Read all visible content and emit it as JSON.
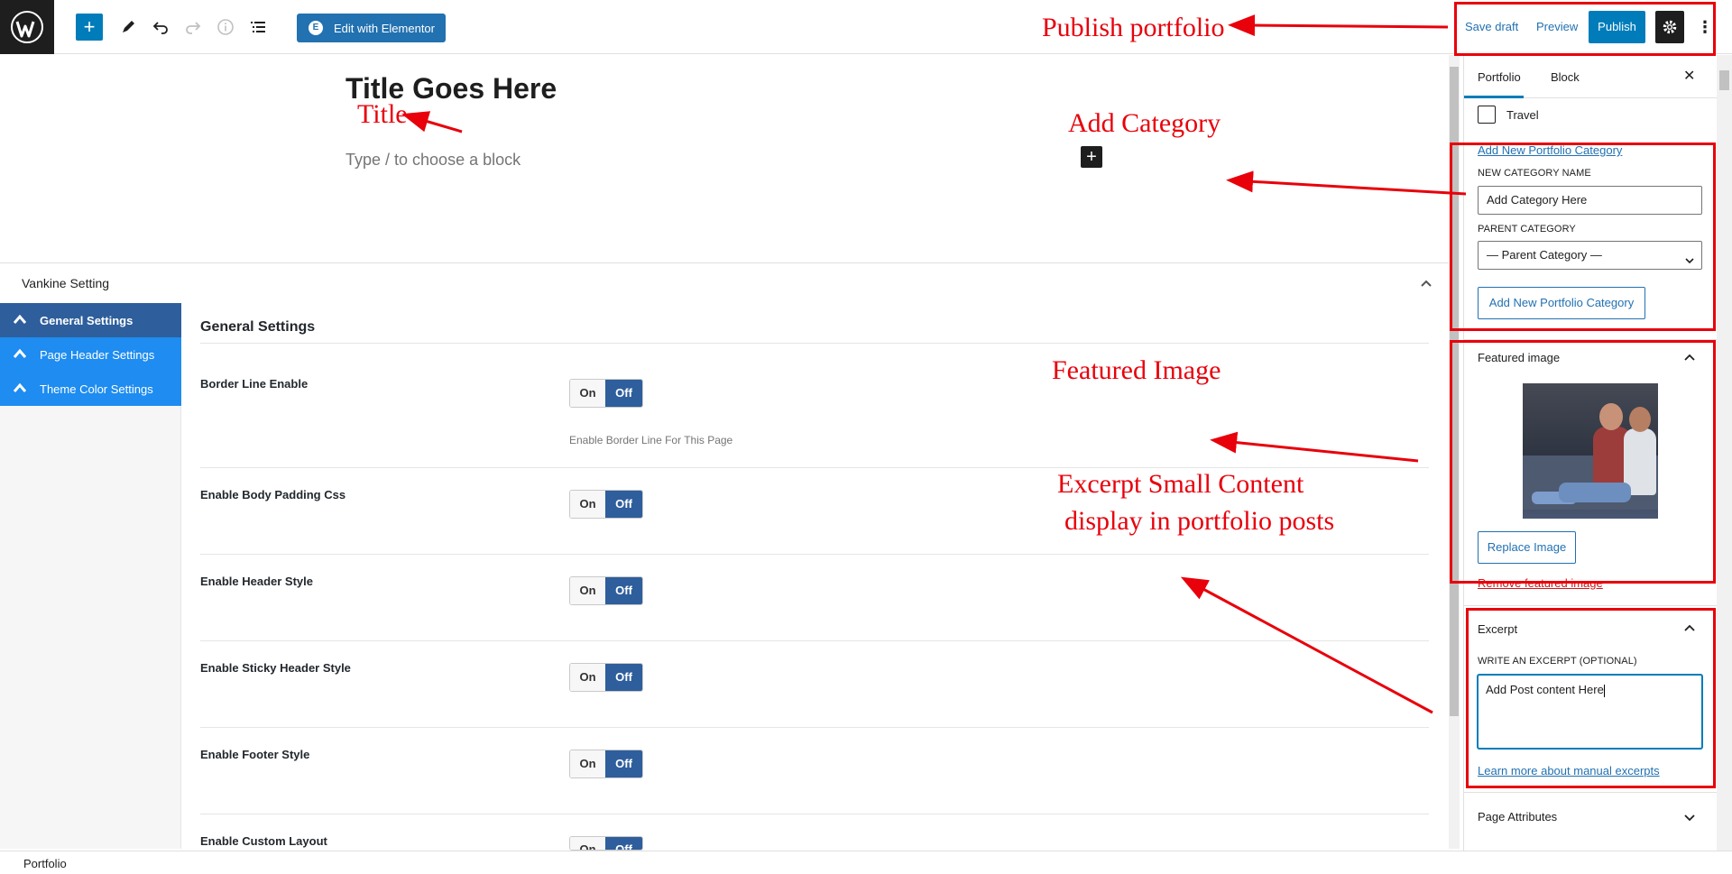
{
  "toolbar": {
    "add_label": "+",
    "elementor_label": "Edit with Elementor",
    "elementor_icon": "E",
    "save_draft": "Save draft",
    "preview": "Preview",
    "publish": "Publish",
    "more": "⋮",
    "accent_color": "#007cba"
  },
  "editor": {
    "post_title": "Title Goes Here",
    "block_placeholder": "Type / to choose a block",
    "inline_add": "+"
  },
  "metabox": {
    "title": "Vankine Setting",
    "nav": [
      {
        "label": "General Settings",
        "active": true
      },
      {
        "label": "Page Header Settings",
        "active": false
      },
      {
        "label": "Theme Color Settings",
        "active": false
      }
    ],
    "heading": "General Settings",
    "rows": [
      {
        "label": "Border Line Enable",
        "on": "On",
        "off": "Off",
        "description": "Enable Border Line For This Page"
      },
      {
        "label": "Enable Body Padding Css",
        "on": "On",
        "off": "Off"
      },
      {
        "label": "Enable Header Style",
        "on": "On",
        "off": "Off"
      },
      {
        "label": "Enable Sticky Header Style",
        "on": "On",
        "off": "Off"
      },
      {
        "label": "Enable Footer Style",
        "on": "On",
        "off": "Off"
      },
      {
        "label": "Enable Custom Layout",
        "on": "On",
        "off": "Off"
      }
    ]
  },
  "footer": {
    "breadcrumb": "Portfolio"
  },
  "sidebar": {
    "tabs": [
      "Portfolio",
      "Block"
    ],
    "close": "✕",
    "category_checkbox": "Travel",
    "add_new_link": "Add New Portfolio Category",
    "new_category_label": "NEW CATEGORY NAME",
    "new_category_value": "Add Category Here",
    "parent_category_label": "PARENT CATEGORY",
    "parent_category_value": "— Parent Category —",
    "add_new_button": "Add New Portfolio Category",
    "featured_image_title": "Featured image",
    "replace_image": "Replace Image",
    "remove_image": "Remove featured image",
    "excerpt_title": "Excerpt",
    "excerpt_label": "WRITE AN EXCERPT (OPTIONAL)",
    "excerpt_value": "Add Post content Here",
    "excerpt_link": "Learn more about manual excerpts",
    "page_attributes": "Page Attributes"
  },
  "annotations": {
    "publish": "Publish portfolio",
    "title": "Title",
    "category": "Add Category",
    "featured": "Featured Image",
    "excerpt_line1": "Excerpt Small Content",
    "excerpt_line2": "display in portfolio posts",
    "color": "#e8000b"
  }
}
